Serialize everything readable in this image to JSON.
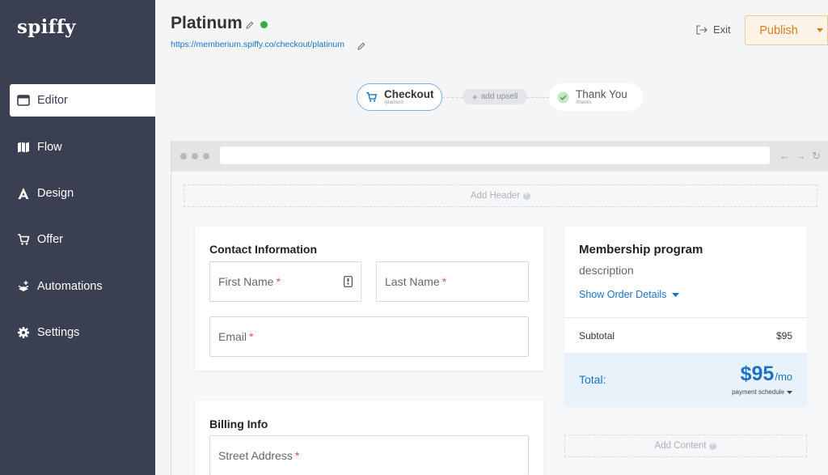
{
  "app": {
    "logo": "spiffy"
  },
  "sidebar": {
    "items": [
      {
        "label": "Editor",
        "icon": "editor-icon",
        "active": true
      },
      {
        "label": "Flow",
        "icon": "map-icon"
      },
      {
        "label": "Design",
        "icon": "design-icon"
      },
      {
        "label": "Offer",
        "icon": "cart-icon"
      },
      {
        "label": "Automations",
        "icon": "automations-icon"
      },
      {
        "label": "Settings",
        "icon": "gear-icon"
      }
    ]
  },
  "header": {
    "title": "Platinum",
    "status_color": "#3bab3f",
    "url": "https://memberium.spiffy.co/checkout/platinum",
    "exit_label": "Exit",
    "publish_label": "Publish"
  },
  "flow": {
    "checkout": {
      "name": "Checkout",
      "path": "/platinum"
    },
    "add_upsell": "add upsell",
    "thank_you": {
      "name": "Thank You",
      "path": "/thanks"
    }
  },
  "canvas": {
    "add_header": "Add Header",
    "add_content": "Add Content",
    "contact": {
      "heading": "Contact Information",
      "first_name": "First Name",
      "last_name": "Last Name",
      "email": "Email",
      "required_mark": "*"
    },
    "billing": {
      "heading": "Billing Info",
      "street": "Street Address"
    },
    "summary": {
      "title": "Membership program",
      "description": "description",
      "show_details": "Show Order Details",
      "subtotal_label": "Subtotal",
      "subtotal_value": "$95",
      "total_label": "Total:",
      "total_amount": "$95",
      "total_unit": "/mo",
      "payment_schedule": "payment schedule"
    }
  },
  "colors": {
    "sidebar_bg": "#3a3f51",
    "accent_blue": "#1a73c8",
    "publish_orange": "#e07b1c",
    "required_red": "#e05555"
  }
}
